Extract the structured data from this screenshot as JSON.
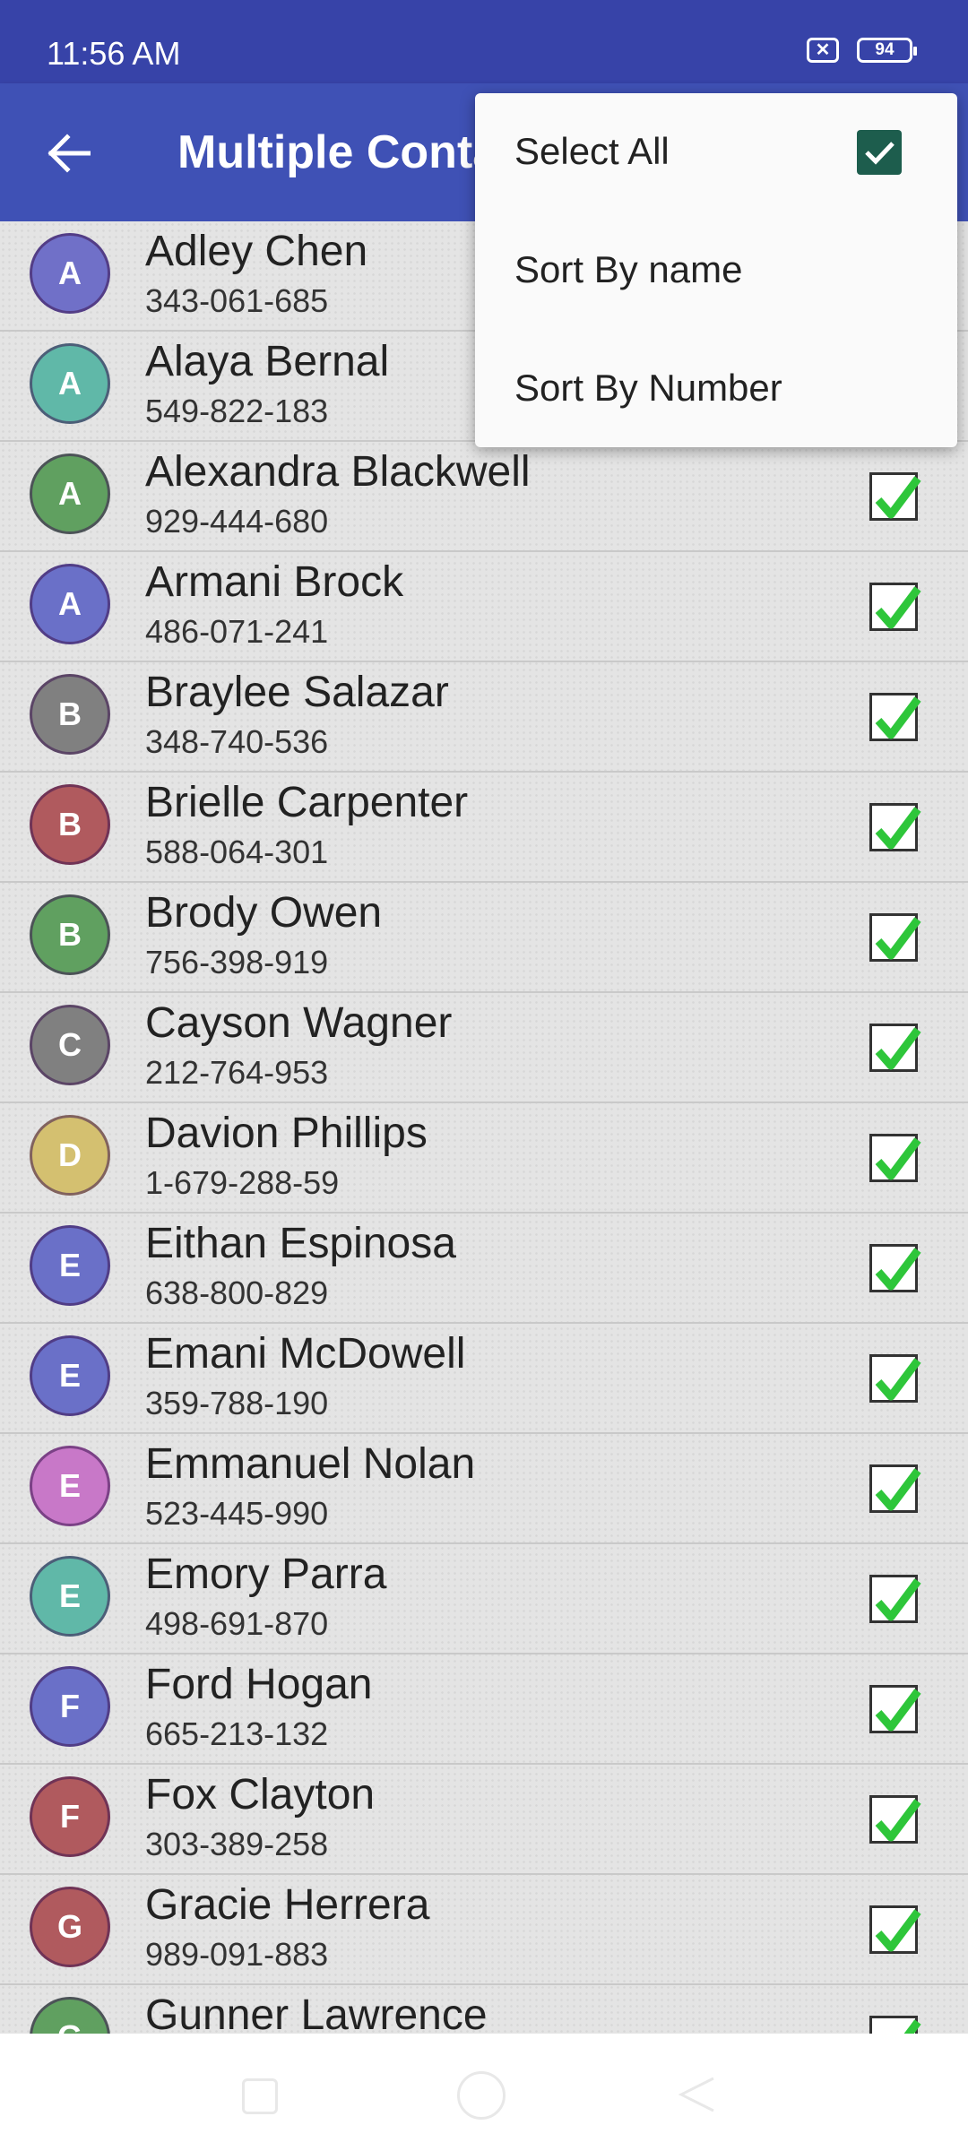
{
  "status_bar": {
    "time": "11:56 AM",
    "sim_icon": "sim-x-icon",
    "battery_level": "94"
  },
  "app_bar": {
    "title": "Multiple Contacts",
    "back_icon": "arrow-back-icon"
  },
  "menu": {
    "select_all": {
      "label": "Select All",
      "checked": true
    },
    "sort_by_name": "Sort By name",
    "sort_by_number": "Sort By Number"
  },
  "contacts": [
    {
      "initial": "A",
      "name": "Adley Chen",
      "number": "343-061-685",
      "color": "#7070c8",
      "checked": true
    },
    {
      "initial": "A",
      "name": "Alaya Bernal",
      "number": "549-822-183",
      "color": "#60b8a8",
      "checked": true
    },
    {
      "initial": "A",
      "name": "Alexandra Blackwell",
      "number": "929-444-680",
      "color": "#60a060",
      "checked": true
    },
    {
      "initial": "A",
      "name": "Armani Brock",
      "number": "486-071-241",
      "color": "#6a70c8",
      "checked": true
    },
    {
      "initial": "B",
      "name": "Braylee Salazar",
      "number": "348-740-536",
      "color": "#808080",
      "checked": true
    },
    {
      "initial": "B",
      "name": "Brielle Carpenter",
      "number": "588-064-301",
      "color": "#b05a5e",
      "checked": true
    },
    {
      "initial": "B",
      "name": "Brody Owen",
      "number": "756-398-919",
      "color": "#60a060",
      "checked": true
    },
    {
      "initial": "C",
      "name": "Cayson Wagner",
      "number": "212-764-953",
      "color": "#808080",
      "checked": true
    },
    {
      "initial": "D",
      "name": "Davion Phillips",
      "number": "1-679-288-59",
      "color": "#d4c070",
      "checked": true
    },
    {
      "initial": "E",
      "name": "Eithan Espinosa",
      "number": "638-800-829",
      "color": "#6a70c8",
      "checked": true
    },
    {
      "initial": "E",
      "name": "Emani McDowell",
      "number": "359-788-190",
      "color": "#6a70c8",
      "checked": true
    },
    {
      "initial": "E",
      "name": "Emmanuel Nolan",
      "number": "523-445-990",
      "color": "#c878c8",
      "checked": true
    },
    {
      "initial": "E",
      "name": "Emory Parra",
      "number": "498-691-870",
      "color": "#60b8a8",
      "checked": true
    },
    {
      "initial": "F",
      "name": "Ford Hogan",
      "number": "665-213-132",
      "color": "#6a70c8",
      "checked": true
    },
    {
      "initial": "F",
      "name": "Fox Clayton",
      "number": "303-389-258",
      "color": "#b05a5e",
      "checked": true
    },
    {
      "initial": "G",
      "name": "Gracie Herrera",
      "number": "989-091-883",
      "color": "#b05a5e",
      "checked": true
    },
    {
      "initial": "G",
      "name": "Gunner Lawrence",
      "number": "",
      "color": "#60a060",
      "checked": true
    }
  ],
  "nav_bar": {
    "recent_icon": "square-icon",
    "home_icon": "circle-home-icon",
    "back_icon": "triangle-back-icon"
  }
}
